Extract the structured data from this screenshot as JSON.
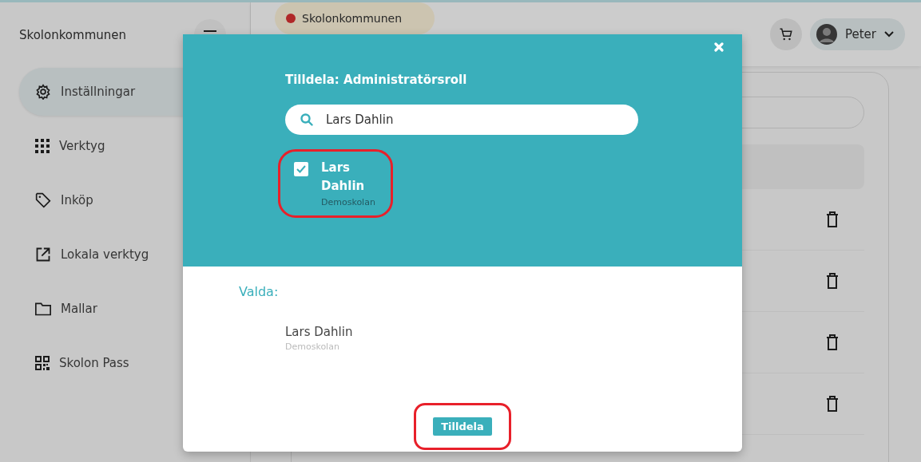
{
  "sidebar": {
    "title": "Skolonkommunen",
    "items": [
      {
        "label": "Inställningar",
        "kind": "gear",
        "selected": true
      },
      {
        "label": "Verktyg",
        "kind": "grid",
        "selected": false
      },
      {
        "label": "Inköp",
        "kind": "tag",
        "selected": false
      },
      {
        "label": "Lokala verktyg",
        "kind": "external",
        "selected": false
      },
      {
        "label": "Mallar",
        "kind": "folder",
        "selected": false
      },
      {
        "label": "Skolon Pass",
        "kind": "qr",
        "selected": false
      }
    ]
  },
  "header": {
    "org_chip": "Skolonkommunen",
    "user": "Peter"
  },
  "modal": {
    "title": "Tilldela: Administratörsroll",
    "search": {
      "value": "Lars Dahlin"
    },
    "results": [
      {
        "name": "Lars Dahlin",
        "school": "Demoskolan",
        "checked": true
      }
    ],
    "selected_label": "Valda:",
    "selected": [
      {
        "name": "Lars Dahlin",
        "school": "Demoskolan"
      }
    ],
    "button": "Tilldela"
  }
}
